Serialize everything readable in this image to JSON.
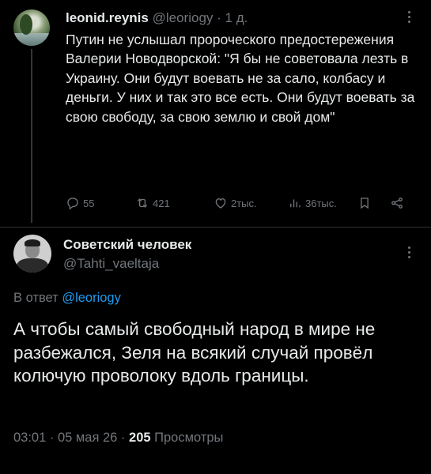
{
  "tweet1": {
    "display_name": "leonid.reynis",
    "handle": "@leoriogy",
    "separator": "·",
    "time": "1 д.",
    "text": "Путин не услышал пророческого предостережения Валерии Новодворской: \"Я бы не советовала лезть в Украину. Они будут воевать не за сало, колбасу и деньги. У них и так это все есть. Они будут воевать за свою свободу, за свою землю и свой дом\"",
    "replies": "55",
    "retweets": "421",
    "likes": "2тыс.",
    "views": "36тыс."
  },
  "tweet2": {
    "display_name": "Советский человек",
    "handle": "@Tahti_vaeltaja",
    "reply_prefix": "В ответ",
    "reply_handle": "@leoriogy",
    "text": "А чтобы самый свободный народ в мире не разбежался, Зеля на всякий случай провёл колючую проволоку вдоль границы.",
    "time": "03:01",
    "sep1": "·",
    "date": "05 мая 26",
    "sep2": "·",
    "views_count": "205",
    "views_label": "Просмотры"
  },
  "colors": {
    "background": "#000000",
    "text": "#e7e9ea",
    "muted": "#71767b",
    "link": "#1d9bf0",
    "divider": "#2f3336"
  },
  "icons": [
    "more-icon",
    "reply-icon",
    "retweet-icon",
    "like-icon",
    "views-icon",
    "bookmark-icon",
    "share-icon"
  ]
}
